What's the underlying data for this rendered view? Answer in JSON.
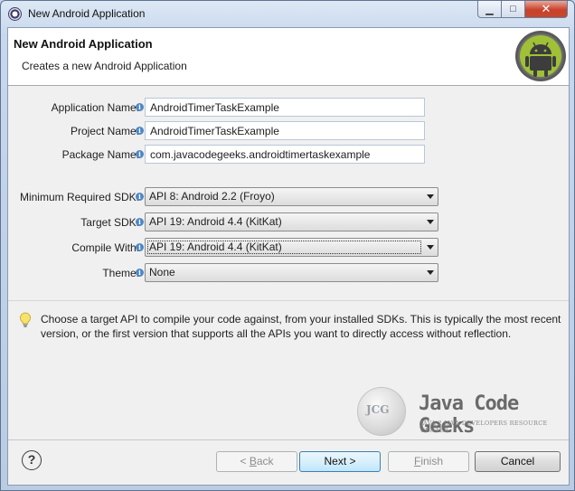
{
  "window": {
    "title": "New Android Application",
    "minimize_glyph": "▁",
    "maximize_glyph": "□",
    "close_glyph": "✕"
  },
  "banner": {
    "title": "New Android Application",
    "subtitle": "Creates a new Android Application",
    "logo_icon": "android-robot-icon"
  },
  "form": {
    "application_name": {
      "label": "Application Name:",
      "value": "AndroidTimerTaskExample"
    },
    "project_name": {
      "label": "Project Name:",
      "value": "AndroidTimerTaskExample"
    },
    "package_name": {
      "label": "Package Name:",
      "value": "com.javacodegeeks.androidtimertaskexample"
    },
    "min_sdk": {
      "label": "Minimum Required SDK:",
      "value": "API 8: Android 2.2 (Froyo)"
    },
    "target_sdk": {
      "label": "Target SDK:",
      "value": "API 19: Android 4.4 (KitKat)"
    },
    "compile_with": {
      "label": "Compile With:",
      "value": "API 19: Android 4.4 (KitKat)"
    },
    "theme": {
      "label": "Theme:",
      "value": "None"
    },
    "info_glyph": "i"
  },
  "hint": {
    "icon": "lightbulb-icon",
    "text": "Choose a target API to compile your code against, from your installed SDKs. This is typically the most recent version, or the first version that supports all the APIs you want to directly access without reflection."
  },
  "watermark": {
    "mark": "JCG",
    "name": "Java Code Geeks",
    "tagline": "JAVA 2 JAVA DEVELOPERS RESOURCE CENTER"
  },
  "buttons": {
    "help_glyph": "?",
    "back_arrow": "< ",
    "back_mnemonic": "B",
    "back_rest": "ack",
    "next": "Next >",
    "finish_mnemonic": "F",
    "finish_rest": "inish",
    "cancel": "Cancel"
  },
  "colors": {
    "default_button_border": "#3c7fb1",
    "info_icon": "#4e86c8",
    "android_green": "#9fc037"
  }
}
